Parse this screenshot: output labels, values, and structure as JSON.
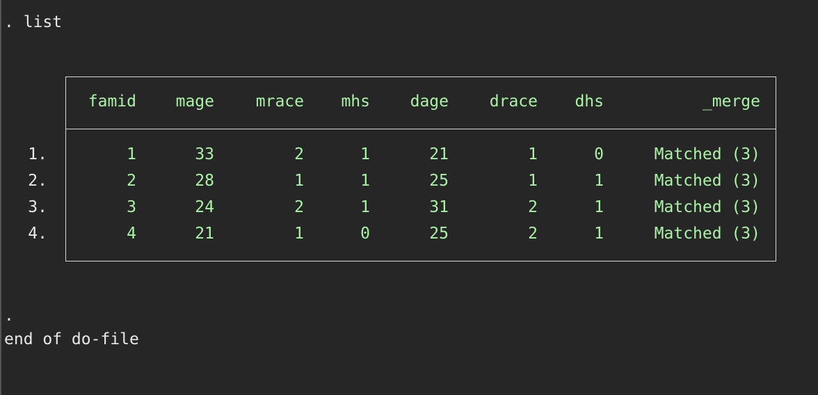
{
  "console": {
    "command_line": ". list",
    "dot_line": ".",
    "end_line": "end of do-file"
  },
  "table": {
    "headers": [
      "famid",
      "mage",
      "mrace",
      "mhs",
      "dage",
      "drace",
      "dhs",
      "_merge"
    ],
    "rows": [
      {
        "obs": "1.",
        "cells": [
          "1",
          "33",
          "2",
          "1",
          "21",
          "1",
          "0",
          "Matched (3)"
        ]
      },
      {
        "obs": "2.",
        "cells": [
          "2",
          "28",
          "1",
          "1",
          "25",
          "1",
          "1",
          "Matched (3)"
        ]
      },
      {
        "obs": "3.",
        "cells": [
          "3",
          "24",
          "2",
          "1",
          "31",
          "2",
          "1",
          "Matched (3)"
        ]
      },
      {
        "obs": "4.",
        "cells": [
          "4",
          "21",
          "1",
          "0",
          "25",
          "2",
          "1",
          "Matched (3)"
        ]
      }
    ]
  },
  "colors": {
    "background": "#262626",
    "text": "#e8e8e8",
    "result_green": "#a9f2a6",
    "table_border": "#d6d6d6"
  }
}
